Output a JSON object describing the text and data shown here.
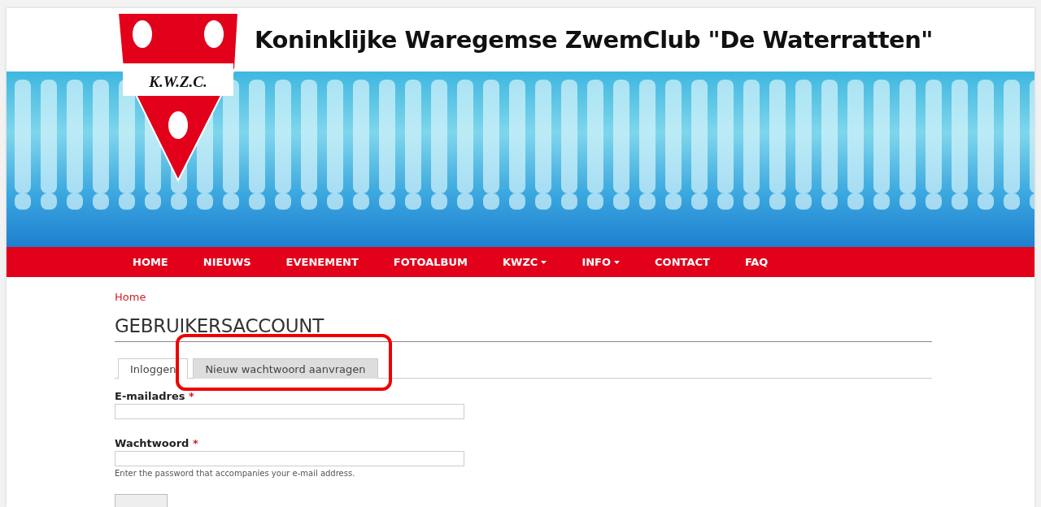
{
  "header": {
    "logo_text": "K.W.Z.C.",
    "title": "Koninklijke Waregemse ZwemClub \"De Waterratten\""
  },
  "nav": [
    {
      "label": "HOME",
      "dropdown": false
    },
    {
      "label": "NIEUWS",
      "dropdown": false
    },
    {
      "label": "EVENEMENT",
      "dropdown": false
    },
    {
      "label": "FOTOALBUM",
      "dropdown": false
    },
    {
      "label": "KWZC",
      "dropdown": true
    },
    {
      "label": "INFO",
      "dropdown": true
    },
    {
      "label": "CONTACT",
      "dropdown": false
    },
    {
      "label": "FAQ",
      "dropdown": false
    }
  ],
  "breadcrumb": "Home",
  "page_title": "GEBRUIKERSACCOUNT",
  "tabs": [
    {
      "label": "Inloggen",
      "selected": true,
      "highlighted": false
    },
    {
      "label": "Nieuw wachtwoord aanvragen",
      "selected": false,
      "highlighted": true
    }
  ],
  "fields": [
    {
      "label": "E-mailadres",
      "required": true
    },
    {
      "label": "Wachtwoord",
      "required": true,
      "help": "Enter the password that accompanies your e-mail address."
    }
  ],
  "required_mark": "*"
}
